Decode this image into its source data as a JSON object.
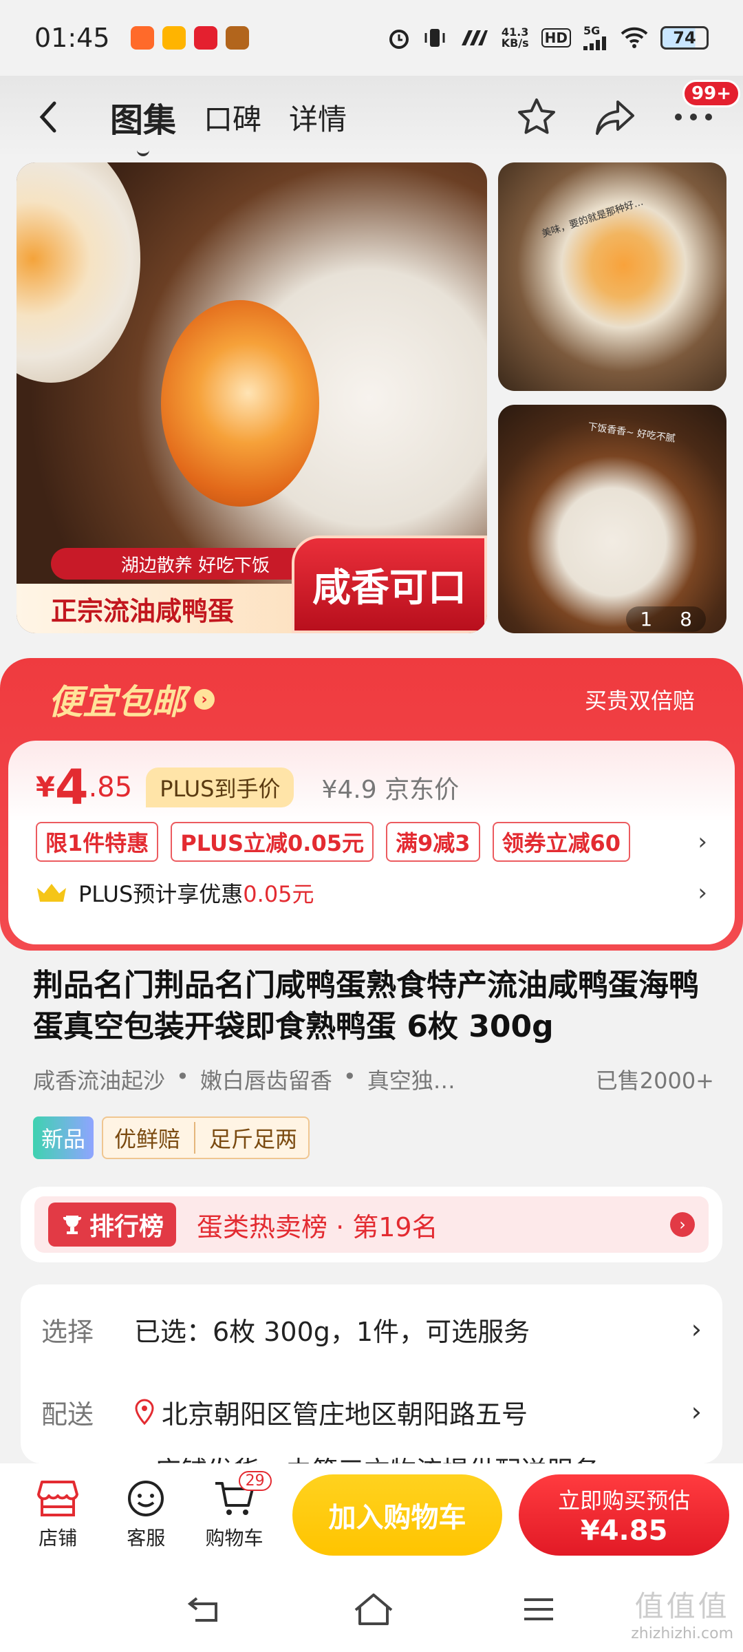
{
  "status_bar": {
    "time": "01:45",
    "net_speed": "41.3",
    "net_unit": "KB/s",
    "hd": "HD",
    "signal": "5G",
    "battery": "74"
  },
  "header": {
    "tabs": [
      "图集",
      "口碑",
      "详情"
    ],
    "active_tab": "图集",
    "more_badge": "99+"
  },
  "gallery": {
    "main_tagline": "湖边散养 好吃下饭",
    "main_banner": "正宗流油咸鸭蛋",
    "main_banner_right": "咸香可口",
    "side1_text": "美味，要的就是那种好…",
    "side2_text": "下饭香香~ 好吃不腻",
    "counter_current": "1",
    "counter_total": "8"
  },
  "promo": {
    "left": "便宜包邮",
    "right": "买贵双倍赔"
  },
  "price": {
    "currency": "¥",
    "integer": "4",
    "decimal": ".85",
    "plus_label": "PLUS到手价",
    "jd_price": "¥4.9 京东价",
    "coupons": [
      "限1件特惠",
      "PLUS立减0.05元",
      "满9减3",
      "领券立减60"
    ],
    "plus_estimate_prefix": "PLUS预计享优惠",
    "plus_estimate_value": "0.05元"
  },
  "product": {
    "title": "荆品名门荆品名门咸鸭蛋熟食特产流油咸鸭蛋海鸭蛋真空包装开袋即食熟鸭蛋 6枚 300g",
    "features": [
      "咸香流油起沙",
      "嫩白唇齿留香",
      "真空独…"
    ],
    "sold": "已售2000+",
    "tag_new": "新品",
    "tag_fresh": "优鲜赔",
    "tag_weight": "足斤足两"
  },
  "rank": {
    "badge": "排行榜",
    "text": "蛋类热卖榜 · 第19名"
  },
  "options": {
    "select_label": "选择",
    "select_value": "已选：6枚 300g，1件，可选服务",
    "delivery_label": "配送",
    "delivery_value": "北京朝阳区管庄地区朝阳路五号",
    "delivery_sub": "店铺发货，由第三方物流提供配送服务"
  },
  "bottom_bar": {
    "shop": "店铺",
    "service": "客服",
    "cart": "购物车",
    "cart_count": "29",
    "add_cart": "加入购物车",
    "buy_line1": "立即购买预估",
    "buy_line2": "¥4.85"
  },
  "watermark": {
    "big": "值值值",
    "small": "zhizhizhi.com"
  },
  "colors": {
    "accent_red": "#e32b31",
    "cart_yellow": "#ffc400",
    "plus_gold": "#ffe4a8"
  }
}
